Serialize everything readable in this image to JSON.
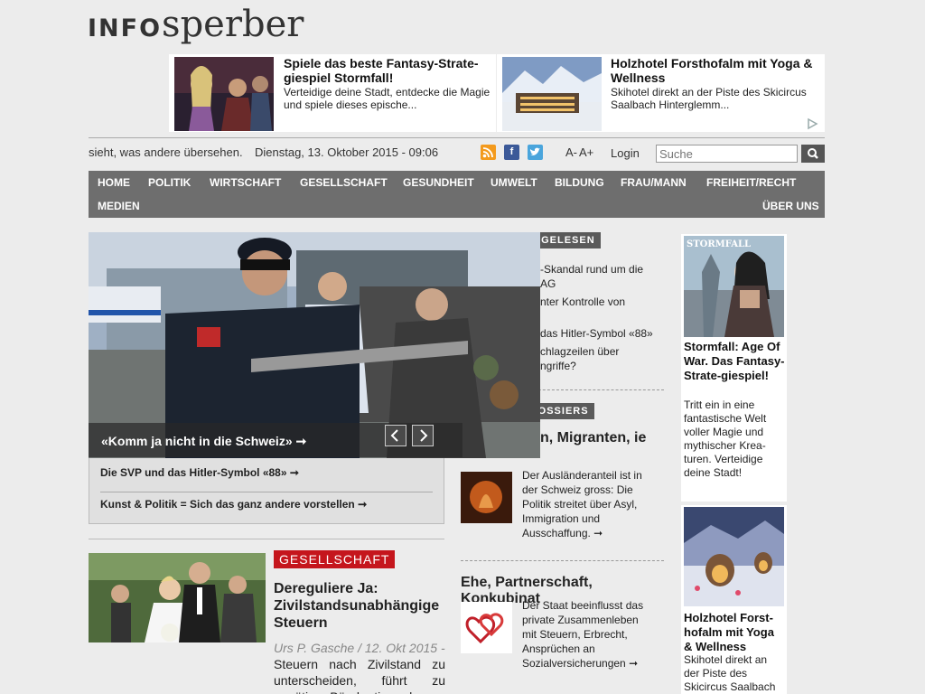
{
  "logo": {
    "part1": "INFO",
    "part2": "sperber"
  },
  "ads": [
    {
      "title": "Spiele das beste Fantasy-Strate-giespiel Stormfall!",
      "desc": "Verteidige deine Stadt, entdecke die Magie und spiele dieses epische..."
    },
    {
      "title": "Holzhotel Forsthofalm mit Yoga & Wellness",
      "desc": "Skihotel direkt an der Piste des Skicircus Saalbach Hinterglemm..."
    }
  ],
  "utility": {
    "tagline": "sieht, was andere übersehen.",
    "date": "Dienstag, 13. Oktober 2015 - 09:06",
    "font_small": "A-",
    "font_large": "A+",
    "login": "Login"
  },
  "search": {
    "placeholder": "Suche"
  },
  "nav": [
    "HOME",
    "POLITIK",
    "WIRTSCHAFT",
    "GESELLSCHAFT",
    "GESUNDHEIT",
    "UMWELT",
    "BILDUNG",
    "FRAU/MANN",
    "FREIHEIT/RECHT",
    "MEDIEN",
    "ÜBER UNS"
  ],
  "slider": {
    "caption": "«Komm ja nicht in die Schweiz» ➞"
  },
  "related": [
    "Die SVP und das Hitler-Symbol «88» ➞",
    "Kunst & Politik = Sich das ganz andere vorstellen ➞"
  ],
  "most_read": {
    "label": "AM MEISTEN GELESEN",
    "items": [
      "-Skandal rund um die AG",
      "nter Kontrolle von",
      "das Hitler-Symbol «88»",
      "chlagzeilen über ngriffe?"
    ]
  },
  "dossiers": {
    "label": "AKTUELLE DOSSIERS",
    "items": [
      {
        "title": "n, Migranten, ie",
        "text": "Der Ausländeranteil ist in der Schweiz gross: Die Politik streitet über Asyl, Immigration und Ausschaffung. ➞"
      },
      {
        "title": "Ehe, Partnerschaft, Konkubinat",
        "text": "Der Staat beeinflusst das private Zusammenleben mit Steuern, Erbrecht, Ansprüchen an Sozialversicherungen ➞"
      }
    ]
  },
  "article": {
    "category": "GESELLSCHAFT",
    "title": "Dereguliere Ja: Zivilstandsunabhängige Steuern",
    "meta": "Urs P. Gasche / 12. Okt 2015 -",
    "body": "Steuern nach Zivilstand zu unterscheiden, führt zu unnötiger Bürokratie und zu"
  },
  "right_ads": [
    {
      "title": "Stormfall: Age Of War. Das Fantasy-Strate-giespiel!",
      "desc": "Tritt ein in eine fantastische Welt voller Magie und mythischer Krea-turen. Verteidige deine Stadt!",
      "img_text": "STORMFALL"
    },
    {
      "title": "Holzhotel Forst-hofalm mit Yoga & Wellness",
      "desc": "Skihotel direkt an der Piste des Skicircus Saalbach"
    }
  ],
  "colors": {
    "nav_bg": "#6e6e6e",
    "category_red": "#c5161d",
    "rss": "#f39a1d",
    "facebook": "#3b5998",
    "twitter": "#4aa5dc"
  }
}
